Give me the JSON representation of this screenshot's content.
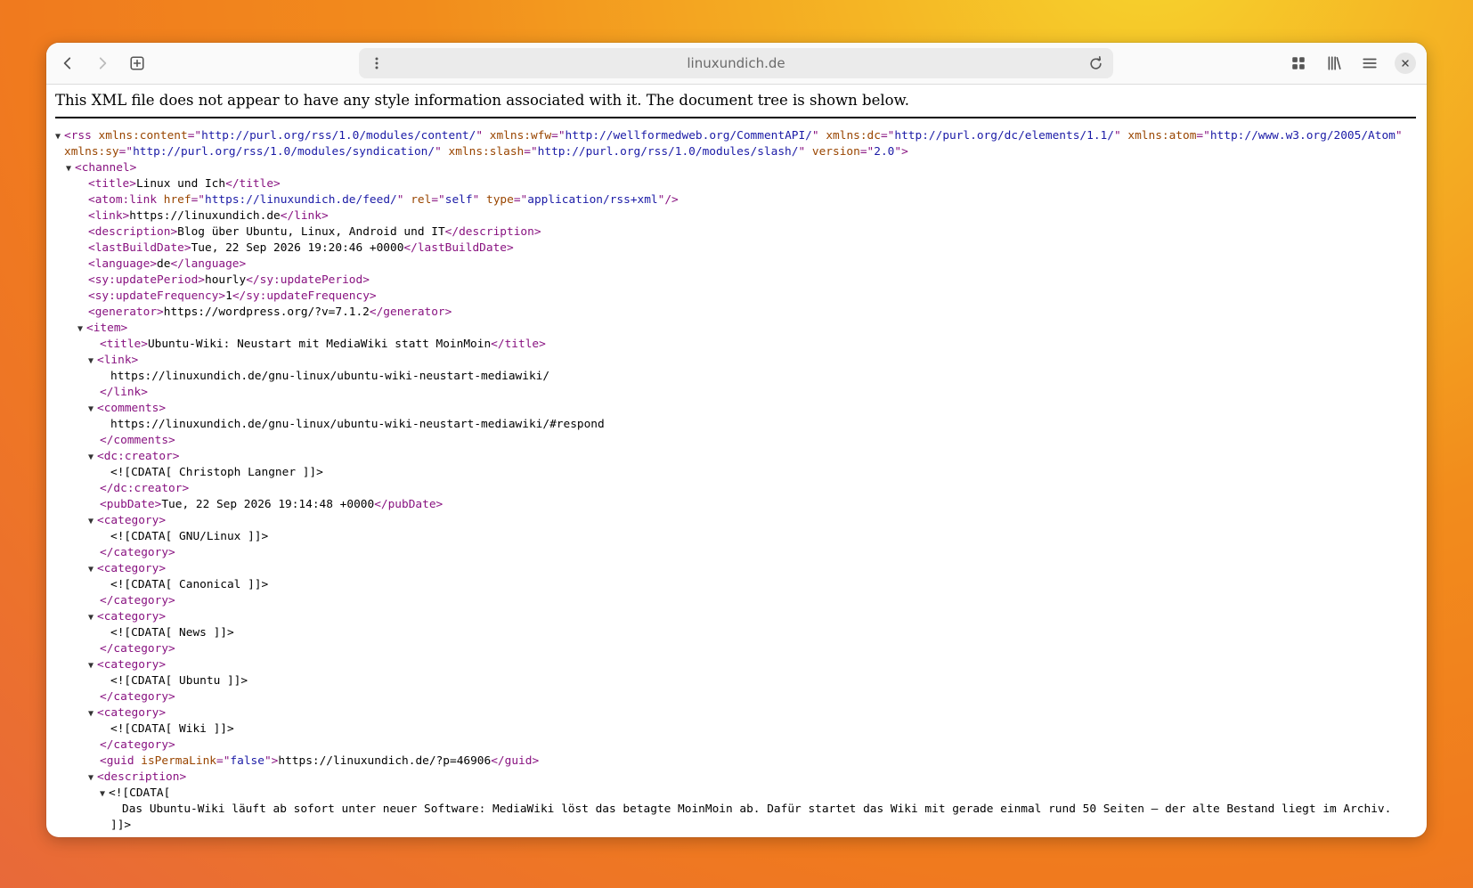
{
  "browser": {
    "url": "linuxundich.de",
    "icons": {
      "back": "back-arrow-icon",
      "forward": "forward-arrow-icon",
      "new_tab": "new-tab-icon",
      "page_menu": "vertical-dots-icon",
      "reload": "reload-icon",
      "tabs_overview": "grid-icon",
      "library": "library-icon",
      "main_menu": "hamburger-icon",
      "close": "close-icon"
    }
  },
  "notice": "This XML file does not appear to have any style information associated with it. The document tree is shown below.",
  "xml": {
    "rss_attrs": [
      {
        "name": "xmlns:content",
        "value": "http://purl.org/rss/1.0/modules/content/"
      },
      {
        "name": "xmlns:wfw",
        "value": "http://wellformedweb.org/CommentAPI/"
      },
      {
        "name": "xmlns:dc",
        "value": "http://purl.org/dc/elements/1.1/"
      },
      {
        "name": "xmlns:atom",
        "value": "http://www.w3.org/2005/Atom"
      },
      {
        "name": "xmlns:sy",
        "value": "http://purl.org/rss/1.0/modules/syndication/"
      },
      {
        "name": "xmlns:slash",
        "value": "http://purl.org/rss/1.0/modules/slash/"
      },
      {
        "name": "version",
        "value": "2.0"
      }
    ],
    "channel": {
      "title": "Linux und Ich",
      "atom_link": {
        "href": "https://linuxundich.de/feed/",
        "rel": "self",
        "type": "application/rss+xml"
      },
      "link": "https://linuxundich.de",
      "description": "Blog über Ubuntu, Linux, Android und IT",
      "lastBuildDate": "Tue, 22 Sep 2026 19:20:46 +0000",
      "language": "de",
      "updatePeriod": "hourly",
      "updateFrequency": "1",
      "generator": "https://wordpress.org/?v=7.1.2"
    },
    "item": {
      "title": "Ubuntu-Wiki: Neustart mit MediaWiki statt MoinMoin",
      "link": "https://linuxundich.de/gnu-linux/ubuntu-wiki-neustart-mediawiki/",
      "comments": "https://linuxundich.de/gnu-linux/ubuntu-wiki-neustart-mediawiki/#respond",
      "creator": "<![CDATA[ Christoph Langner ]]>",
      "pubDate": "Tue, 22 Sep 2026 19:14:48 +0000",
      "categories": [
        "<![CDATA[ GNU/Linux ]]>",
        "<![CDATA[ Canonical ]]>",
        "<![CDATA[ News ]]>",
        "<![CDATA[ Ubuntu ]]>",
        "<![CDATA[ Wiki ]]>"
      ],
      "guid": {
        "isPermaLink": "false",
        "value": "https://linuxundich.de/?p=46906"
      },
      "description_cdata_open": "<![CDATA[",
      "description_text": "Das Ubuntu-Wiki läuft ab sofort unter neuer Software: MediaWiki löst das betagte MoinMoin ab. Dafür startet das Wiki mit gerade einmal rund 50 Seiten – der alte Bestand liegt im Archiv.",
      "description_cdata_close": "]]>"
    }
  }
}
